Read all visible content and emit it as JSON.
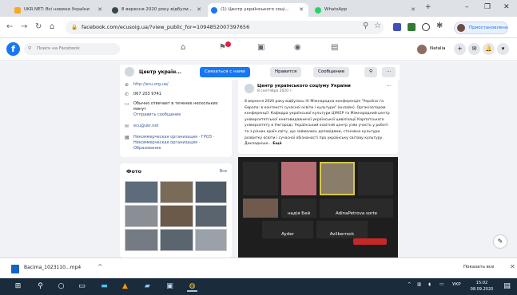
{
  "browser": {
    "tabs": [
      {
        "title": "UKR.NET: Всі новини України",
        "color": "#f9a825"
      },
      {
        "title": "8 вересня 2020 року відбули...",
        "color": "#37474f"
      },
      {
        "title": "(1) Центр українського соці...",
        "color": "#1877f2"
      },
      {
        "title": "WhatsApp",
        "color": "#25d366"
      }
    ],
    "new_tab": "+",
    "address": "facebook.com/ecusoig.ua/?view_public_for=1094852007397656",
    "profile_button": "Приостановлена"
  },
  "facebook": {
    "search_placeholder": "Поиск на Facebook",
    "user_name": "Natalia",
    "page_name": "Центр україн...",
    "buttons": {
      "contact": "Связаться с нами",
      "like": "Нравится",
      "message": "Сообщение"
    }
  },
  "left_info": [
    {
      "icon": "globe-icon",
      "text": "http://ecu.org.ua/"
    },
    {
      "icon": "phone-icon",
      "text": "067 203 9741"
    },
    {
      "icon": "chat-icon",
      "text": "Обычно отвечает в течение нескольких минут"
    },
    {
      "icon": "chat-icon",
      "text": "Отправить сообщение"
    },
    {
      "icon": "mail-icon",
      "text": "ecu@ukr.net"
    },
    {
      "icon": "tag-icon",
      "text": "Некоммерческая организация · ГРОЗ · Некоммерческая организация · Образование"
    }
  ],
  "photos": {
    "title": "Фото",
    "see_all": "Все"
  },
  "post": {
    "author": "Центр українського соціуму України",
    "time": "8 сентября 2020 г.",
    "text": "8 вересня 2020 року відбулась IV Міжнародна конференція \"Україна та Європа: в контексті сучасної освіти і культури\" (онлайн). Організатором конференції: Кафедра української культури ЦУКЕР та Міжнародний центр університетської книговидавничої української цивілізації Карпатського університету в Ужгороді. Український освітній центр узяв участь у роботі та з різних країн світу, що займались доповідями, стосовно культури розвитку освіти і сучасної обізнаності про українську світову культуру. Докладніше...",
    "more": "Ещё"
  },
  "video": {
    "tiles": [
      "",
      "",
      "",
      "",
      "надія Бей",
      "Adina Petrova",
      "Ayder",
      "Avilberrock"
    ],
    "top_label": "AdinaPetrova sorte"
  },
  "download": {
    "file": "Bacima_1023110...mp4",
    "show_all": "Показать все"
  },
  "taskbar": {
    "lang": "УКР",
    "time": "15:02",
    "date": "08.09.2020"
  }
}
